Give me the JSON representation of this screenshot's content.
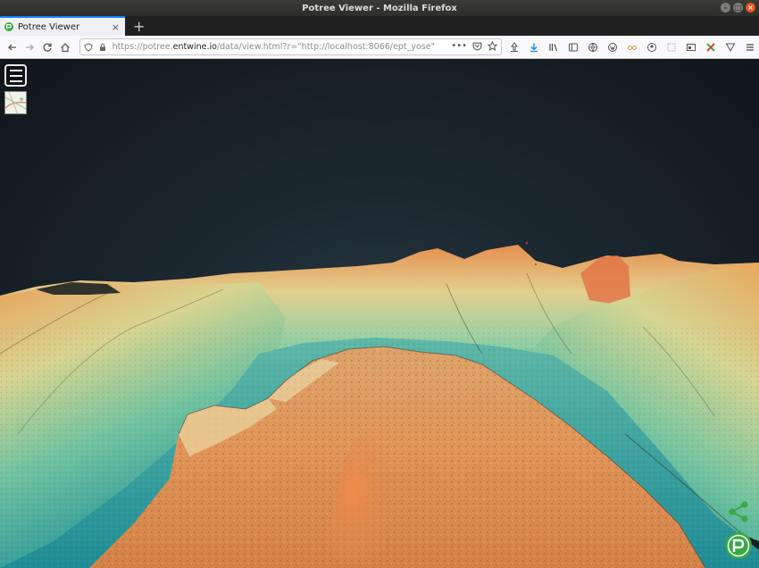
{
  "window": {
    "title": "Potree Viewer - Mozilla Firefox"
  },
  "tab": {
    "title": "Potree Viewer",
    "close": "×",
    "new_tab": "+"
  },
  "address": {
    "prefix": "https://potree.",
    "host": "entwine.io",
    "path": "/data/view.html?r=\"http://localhost:8066/ept_yose\"",
    "more": "•••"
  },
  "icons": {
    "back": "arrow-left-icon",
    "forward": "arrow-right-icon",
    "reload": "reload-icon",
    "home": "home-icon",
    "shield": "tracking-shield-icon",
    "lock": "lock-icon",
    "pocket": "pocket-icon",
    "bookmark": "star-icon",
    "share": "share-icon",
    "logo": "potree-logo-icon"
  },
  "colors": {
    "accent": "#0a84ff",
    "brand_green": "#3aa845",
    "close_button": "#e95420"
  }
}
